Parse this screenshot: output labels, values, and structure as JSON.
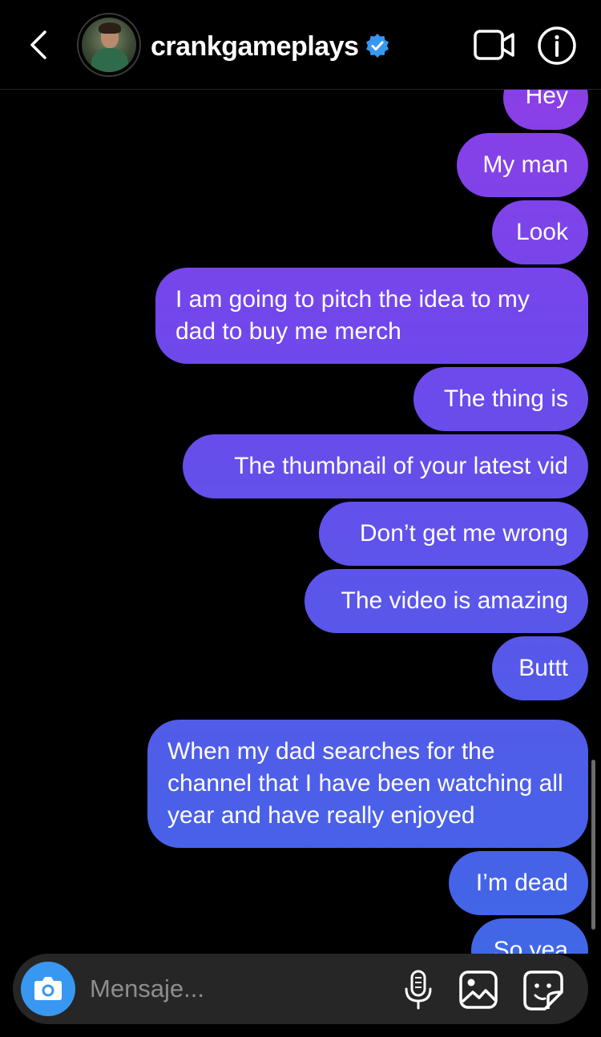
{
  "header": {
    "username": "crankgameplays",
    "verified": true,
    "icons": [
      "chevron-left-icon",
      "verified-badge-icon",
      "video-call-icon",
      "info-icon"
    ]
  },
  "messages": [
    {
      "text": "Hey",
      "sender": "me"
    },
    {
      "text": "My man",
      "sender": "me"
    },
    {
      "text": "Look",
      "sender": "me"
    },
    {
      "text": "I am going to pitch the idea to my dad to buy me merch",
      "sender": "me"
    },
    {
      "text": "The thing is",
      "sender": "me"
    },
    {
      "text": "The thumbnail of your latest vid",
      "sender": "me"
    },
    {
      "text": "Don’t get me wrong",
      "sender": "me"
    },
    {
      "text": "The video is amazing",
      "sender": "me"
    },
    {
      "text": "Buttt",
      "sender": "me"
    },
    {
      "text": "When my dad searches for the channel that I have been watching all year and have really enjoyed",
      "sender": "me"
    },
    {
      "text": "I’m dead",
      "sender": "me"
    },
    {
      "text": "So yea",
      "sender": "me"
    }
  ],
  "composer": {
    "placeholder": "Mensaje...",
    "icons": [
      "camera-icon",
      "microphone-icon",
      "gallery-icon",
      "sticker-icon"
    ]
  },
  "colors": {
    "background": "#000000",
    "bubble_top": "#8b3fe6",
    "bubble_bottom": "#3b6ee5",
    "composer_bg": "#262626",
    "camera_button": "#3897f0",
    "verified_badge": "#3897f0"
  }
}
